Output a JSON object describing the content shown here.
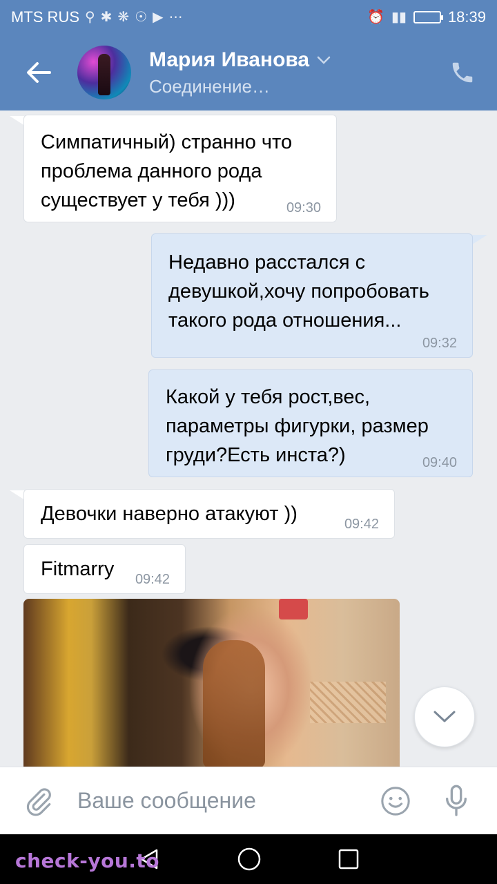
{
  "status_bar": {
    "carrier": "MTS RUS",
    "time": "18:39"
  },
  "header": {
    "contact_name": "Мария Иванова",
    "status": "Соединение…"
  },
  "messages": [
    {
      "direction": "in",
      "text_lines": [
        "Симпатичный) странно что",
        "проблема данного рода",
        "существует у тебя )))"
      ],
      "time": "09:30"
    },
    {
      "direction": "out",
      "text_lines": [
        "Недавно расстался с",
        "девушкой,хочу попробовать",
        "такого рода отношения..."
      ],
      "time": "09:32"
    },
    {
      "direction": "out",
      "text_lines": [
        "Какой у тебя рост,вес,",
        "параметры фигурки, размер",
        "груди?Есть инста?)"
      ],
      "time": "09:40"
    },
    {
      "direction": "in",
      "text_lines": [
        "Девочки наверно атакуют ))"
      ],
      "time": "09:42"
    },
    {
      "direction": "in",
      "text_lines": [
        "Fitmarry"
      ],
      "time": "09:42"
    }
  ],
  "composer": {
    "placeholder": "Ваше сообщение"
  },
  "watermark": "check-you.to",
  "colors": {
    "header_blue": "#5b86bd",
    "outgoing_bubble": "#dce8f7",
    "incoming_bubble": "#ffffff",
    "chat_background": "#ebedf0"
  },
  "icons": [
    "back-arrow-icon",
    "phone-icon",
    "chevron-down-icon",
    "paperclip-icon",
    "emoji-icon",
    "microphone-icon",
    "scroll-down-icon",
    "nav-back-icon",
    "nav-home-icon",
    "nav-recents-icon"
  ]
}
